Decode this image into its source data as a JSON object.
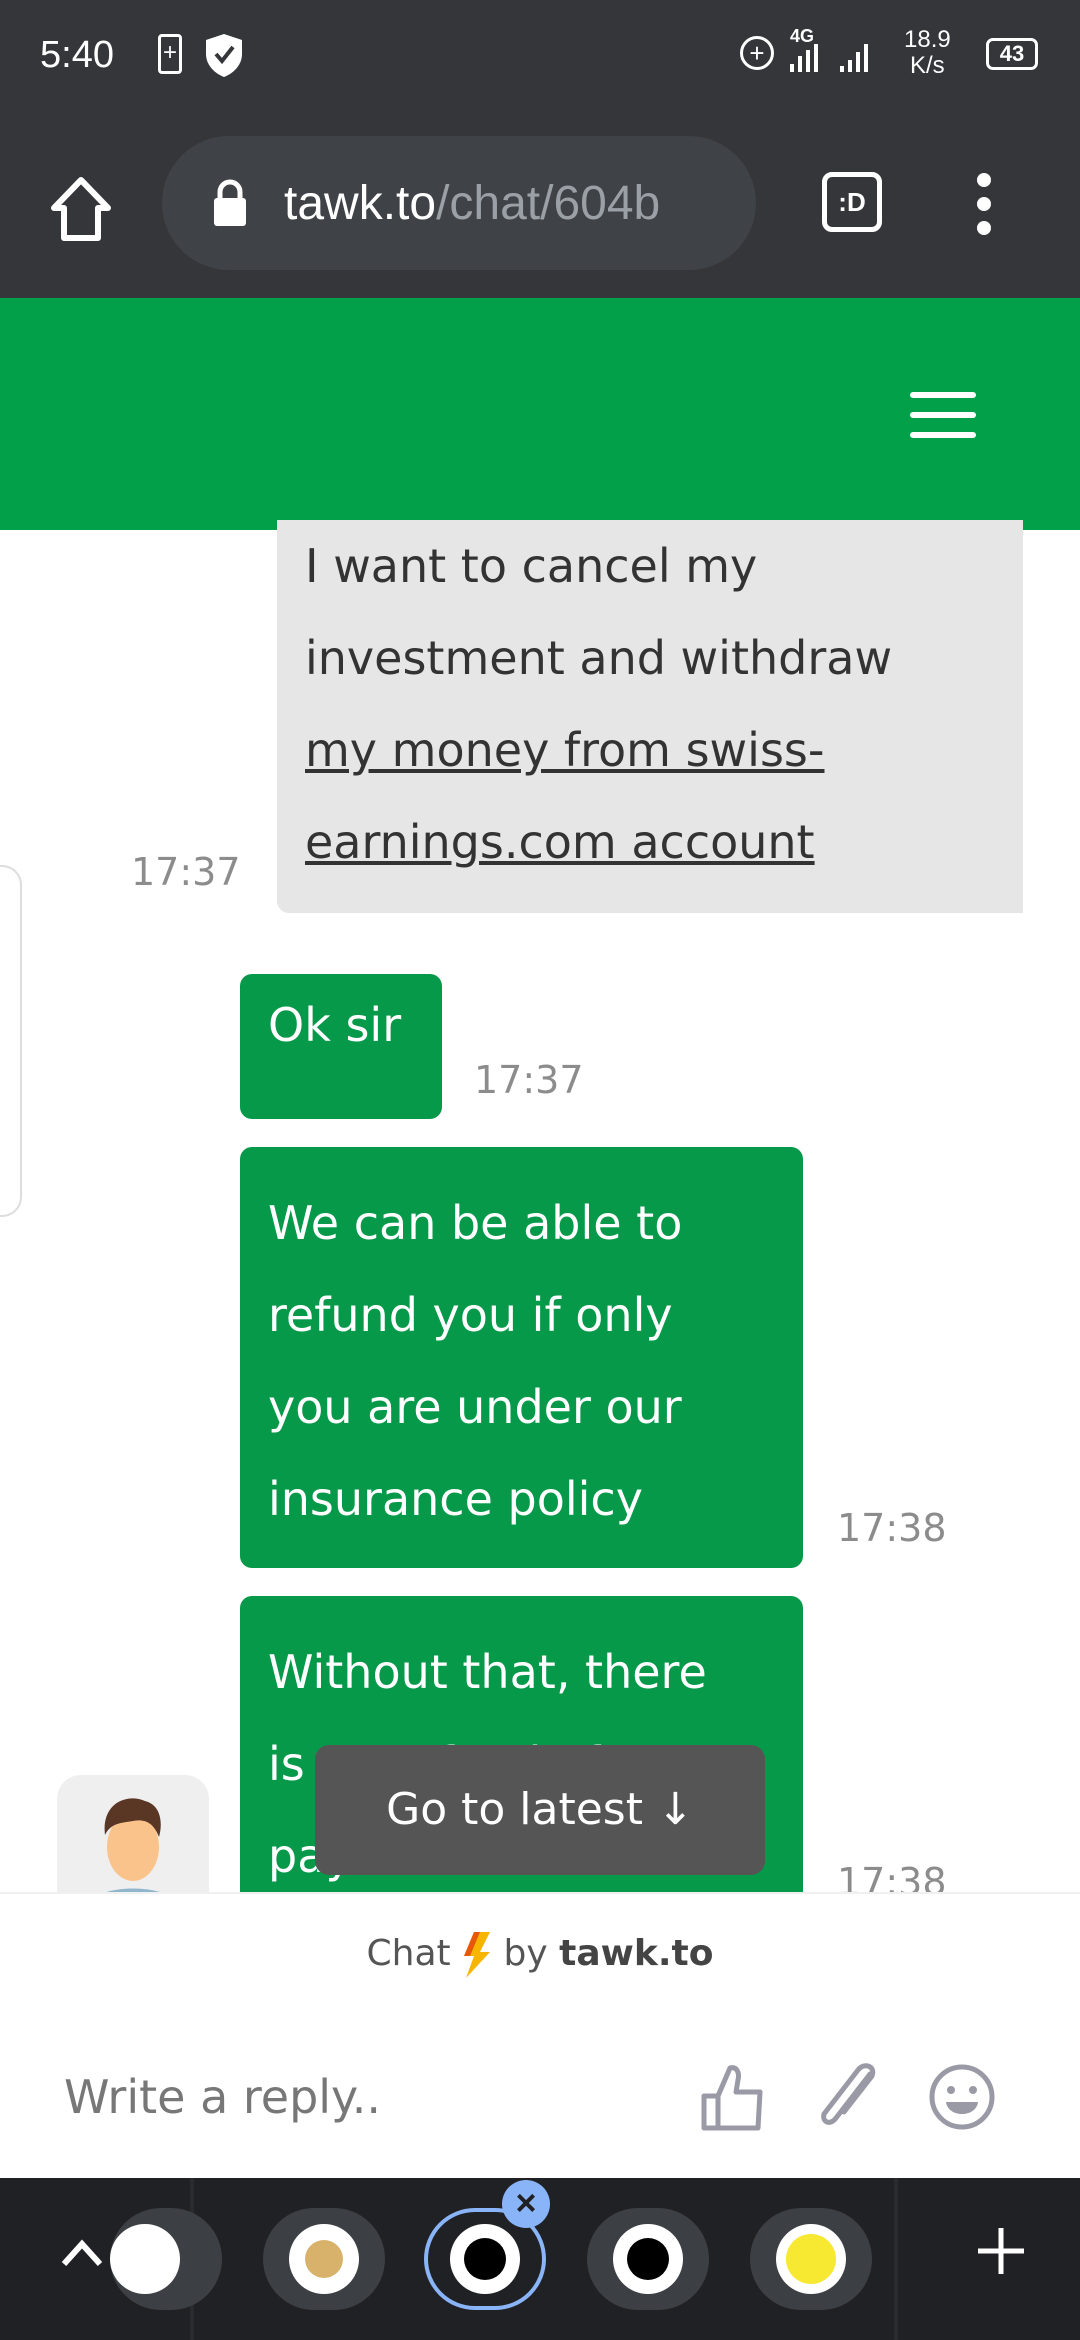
{
  "status_bar": {
    "time": "5:40",
    "network": "4G",
    "speed_value": "18.9",
    "speed_unit": "K/s",
    "battery": "43"
  },
  "browser": {
    "url_host": "tawk.to",
    "url_path": "/chat/604b",
    "tab_switcher_label": ":D"
  },
  "messages": [
    {
      "from": "visitor",
      "lines": [
        "I want to cancel my",
        "investment and withdraw",
        "my money from swiss-",
        "earnings.com account"
      ],
      "link": "swiss-earnings.com",
      "time": "17:37"
    },
    {
      "from": "agent",
      "lines": [
        "Ok sir"
      ],
      "time": "17:37"
    },
    {
      "from": "agent",
      "lines": [
        "We can be able to",
        "refund you if only",
        "you are under our",
        "insurance policy"
      ],
      "time": "17:38"
    },
    {
      "from": "agent",
      "lines": [
        "Without that, there",
        "is no refund after",
        "payment"
      ],
      "time": "17:38"
    }
  ],
  "go_to_latest": "Go to latest",
  "branding": {
    "chat": "Chat",
    "by": "by",
    "brand": "tawk.to"
  },
  "composer": {
    "placeholder": "Write a reply.."
  },
  "colors": {
    "header": "#03a04a",
    "agent_bubble": "#06994a",
    "visitor_bubble": "#e6e6e6",
    "chrome": "#35363a"
  }
}
